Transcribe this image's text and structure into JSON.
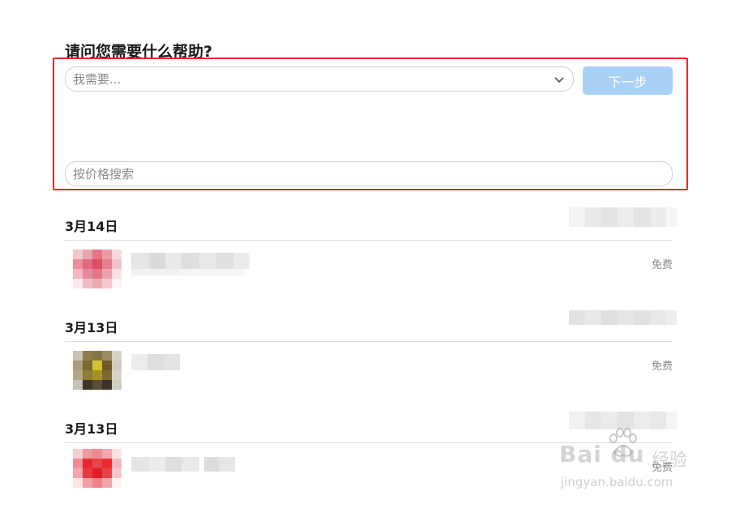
{
  "page": {
    "title": "请问您需要什么帮助?"
  },
  "form": {
    "need_placeholder": "我需要...",
    "next_label": "下一步",
    "price_search_placeholder": "按价格搜索"
  },
  "groups": [
    {
      "date": "3月14日",
      "price": "免费"
    },
    {
      "date": "3月13日",
      "price": "免费"
    },
    {
      "date": "3月13日",
      "price": "免费"
    }
  ],
  "watermark": {
    "brand": "Bai du",
    "cn": "经验",
    "url": "jingyan.baidu.com"
  },
  "colors": {
    "highlight_border": "#e02b2b",
    "next_button_bg": "#a9d0f5"
  },
  "icons": {
    "select_caret": "chevron-down-icon",
    "watermark_logo": "paw-icon"
  }
}
